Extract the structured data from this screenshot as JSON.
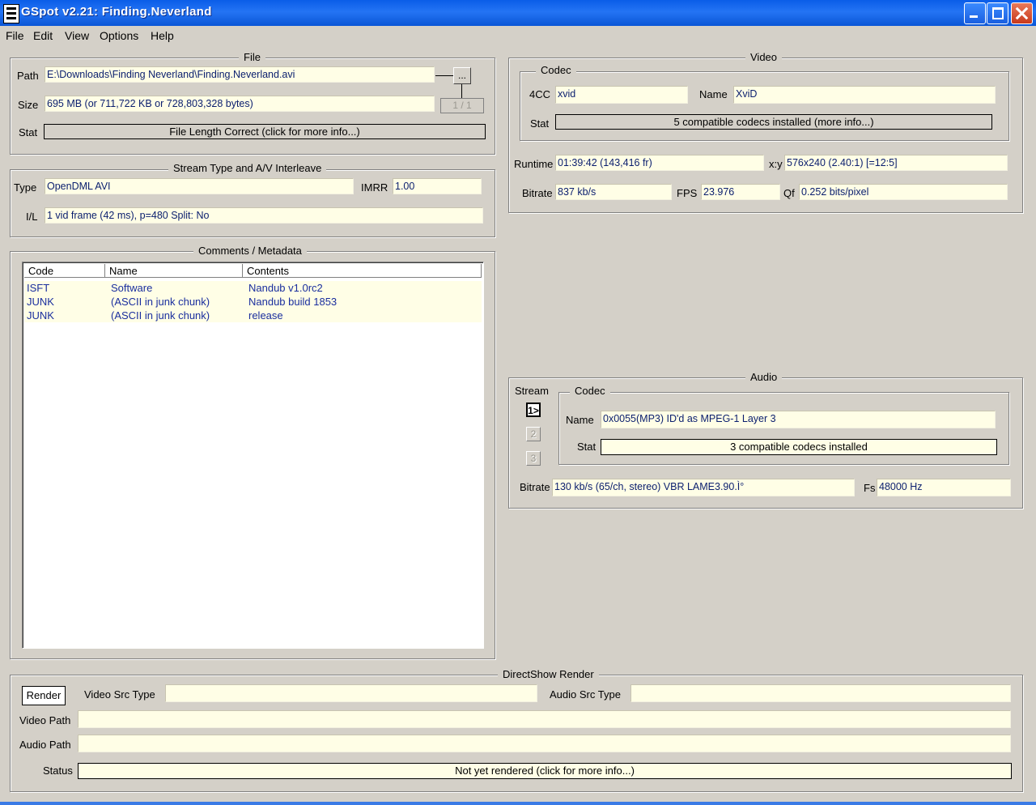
{
  "window": {
    "title": "GSpot v2.21: Finding.Neverland"
  },
  "menu": [
    "File",
    "Edit",
    "View",
    "Options",
    "Help"
  ],
  "file": {
    "title": "File",
    "path_label": "Path",
    "path": "E:\\Downloads\\Finding Neverland\\Finding.Neverland.avi",
    "browse_label": "...",
    "size_label": "Size",
    "size": "695 MB (or 711,722 KB or 728,803,328 bytes)",
    "pages_label": "1 / 1",
    "stat_label": "Stat",
    "stat": "File Length Correct (click for more info...)"
  },
  "stream": {
    "title": "Stream Type and A/V Interleave",
    "type_label": "Type",
    "type": "OpenDML AVI",
    "imrr_label": "IMRR",
    "imrr": "1.00",
    "il_label": "I/L",
    "il": "1 vid frame (42 ms), p=480  Split: No"
  },
  "comments": {
    "title": "Comments / Metadata",
    "columns": [
      "Code",
      "Name",
      "Contents"
    ],
    "rows": [
      [
        "ISFT",
        "Software",
        "Nandub v1.0rc2"
      ],
      [
        "JUNK",
        "(ASCII in junk chunk)",
        "Nandub build 1853"
      ],
      [
        "JUNK",
        "(ASCII in junk chunk)",
        "release"
      ]
    ]
  },
  "video": {
    "title": "Video",
    "codec_title": "Codec",
    "fourcc_label": "4CC",
    "fourcc": "xvid",
    "name_label": "Name",
    "name": "XviD",
    "stat_label": "Stat",
    "stat": "5 compatible codecs installed (more info...)",
    "runtime_label": "Runtime",
    "runtime": "01:39:42 (143,416 fr)",
    "xy_label": "x:y",
    "xy": "576x240 (2.40:1) [=12:5]",
    "bitrate_label": "Bitrate",
    "bitrate": "837 kb/s",
    "fps_label": "FPS",
    "fps": "23.976",
    "qf_label": "Qf",
    "qf": "0.252 bits/pixel"
  },
  "audio": {
    "title": "Audio",
    "stream_label": "Stream",
    "streams": [
      "1>",
      "2",
      "3"
    ],
    "codec_title": "Codec",
    "name_label": "Name",
    "name": "0x0055(MP3) ID'd as MPEG-1 Layer 3",
    "stat_label": "Stat",
    "stat": "3 compatible codecs installed",
    "bitrate_label": "Bitrate",
    "bitrate": "130 kb/s (65/ch, stereo) VBR LAME3.90.Ì°",
    "fs_label": "Fs",
    "fs": "48000 Hz"
  },
  "directshow": {
    "title": "DirectShow Render",
    "render_label": "Render",
    "video_src_label": "Video Src Type",
    "video_src": "",
    "audio_src_label": "Audio Src Type",
    "audio_src": "",
    "video_path_label": "Video Path",
    "video_path": "",
    "audio_path_label": "Audio Path",
    "audio_path": "",
    "status_label": "Status",
    "status": "Not yet rendered (click for more info...)"
  }
}
